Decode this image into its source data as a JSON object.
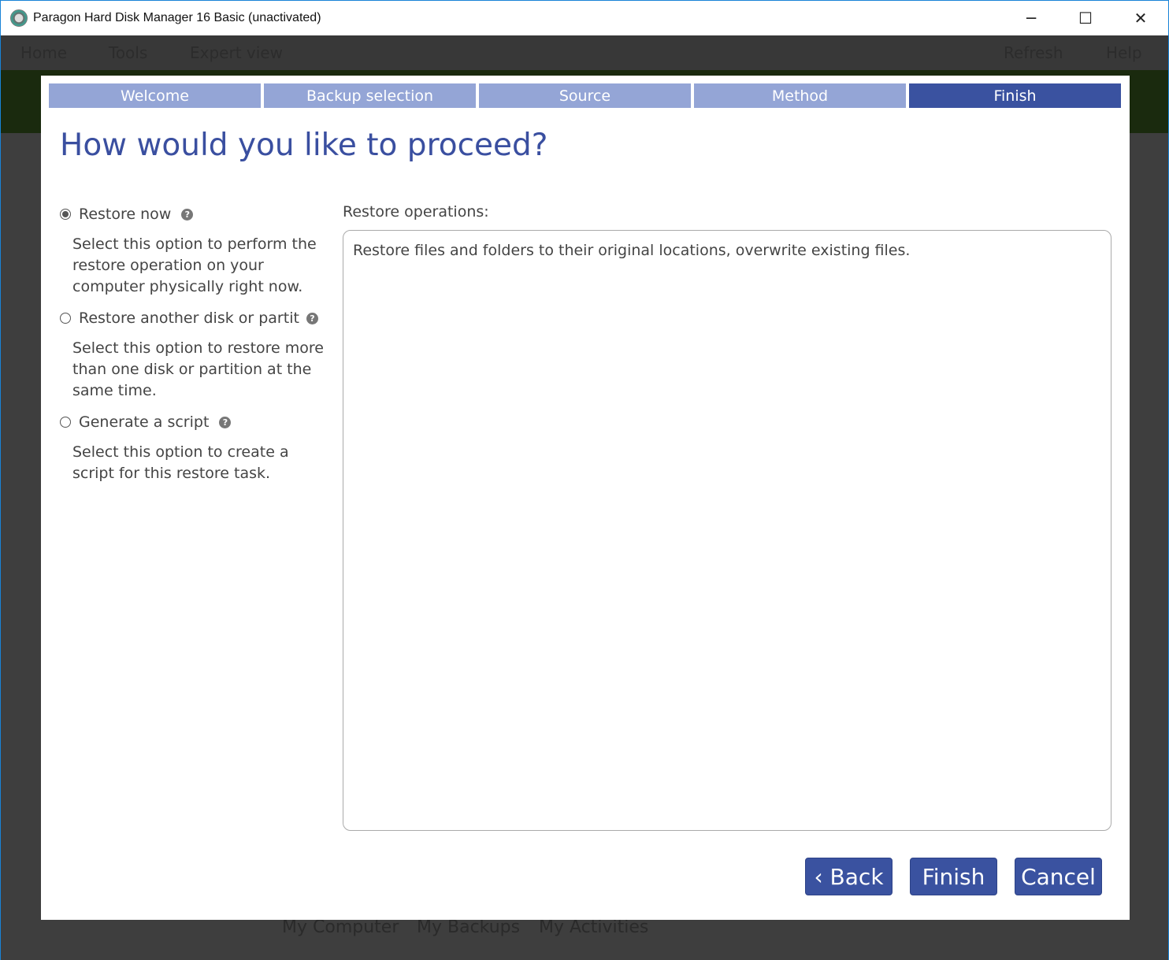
{
  "window": {
    "title": "Paragon Hard Disk Manager 16 Basic (unactivated)",
    "minimize": "─",
    "maximize": "☐",
    "close": "✕"
  },
  "background": {
    "menu": [
      "Home",
      "Tools",
      "Expert view"
    ],
    "menu_right": [
      "Refresh",
      "Help"
    ],
    "bottom_tabs": [
      "My Computer",
      "My Backups",
      "My Activities"
    ]
  },
  "wizard": {
    "steps": [
      {
        "label": "Welcome"
      },
      {
        "label": "Backup selection"
      },
      {
        "label": "Source"
      },
      {
        "label": "Method"
      },
      {
        "label": "Finish",
        "active": true
      }
    ],
    "heading": "How would you like to proceed?",
    "options": [
      {
        "label": "Restore now",
        "selected": true,
        "description": "Select this option to perform the restore operation on your computer physically right now."
      },
      {
        "label": "Restore another disk or partition",
        "selected": false,
        "description": "Select this option to restore more than one disk or partition at the same time."
      },
      {
        "label": "Generate a script",
        "selected": false,
        "description": "Select this option to create a script for this restore task."
      }
    ],
    "help_glyph": "?",
    "operations_label": "Restore operations:",
    "operations_text": "Restore files and folders to their original locations, overwrite existing files.",
    "buttons": {
      "back": "‹ Back",
      "finish": "Finish",
      "cancel": "Cancel"
    }
  },
  "colors": {
    "accent": "#3a52a0",
    "step_inactive": "#94a5d6"
  }
}
